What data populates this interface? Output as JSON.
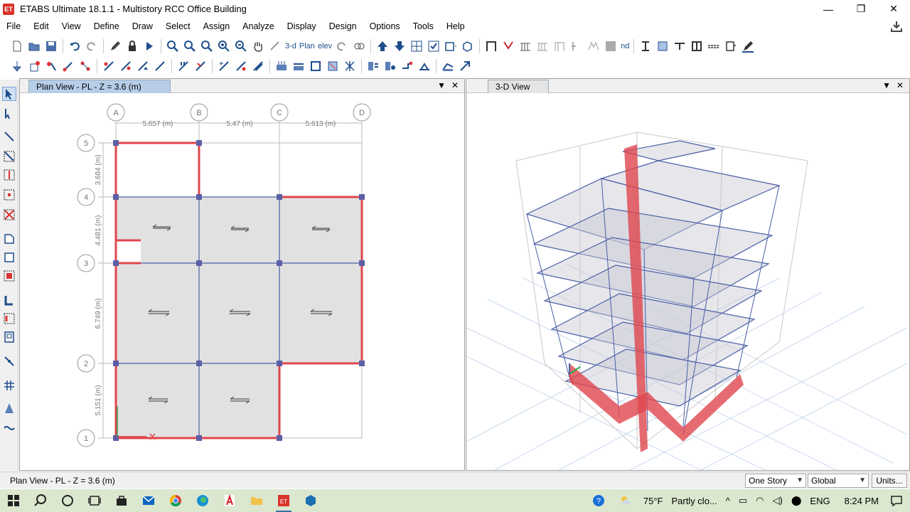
{
  "window": {
    "title": "ETABS Ultimate 18.1.1 - Multistory RCC Office Building",
    "logo": "ET",
    "minimize": "—",
    "restore": "❐",
    "close": "✕"
  },
  "menu": [
    "File",
    "Edit",
    "View",
    "Define",
    "Draw",
    "Select",
    "Assign",
    "Analyze",
    "Display",
    "Design",
    "Options",
    "Tools",
    "Help"
  ],
  "toolbar": {
    "view3d_label": "3-d",
    "plan_label": "Plan",
    "elev_label": "elev",
    "nd_label": "nd"
  },
  "plan_view": {
    "tab": "Plan View - PL - Z = 3.6 (m)",
    "grid_x": [
      "A",
      "B",
      "C",
      "D"
    ],
    "grid_y": [
      "5",
      "4",
      "3",
      "2",
      "1"
    ],
    "dims_x": [
      "5.657 (m)",
      "5.47 (m)",
      "5.613 (m)"
    ],
    "dims_y": [
      "3.684 (m)",
      "4.481 (m)",
      "6.749 (m)",
      "5.151 (m)"
    ]
  },
  "view3d": {
    "tab": "3-D View"
  },
  "status": {
    "text": "Plan View - PL - Z = 3.6 (m)",
    "story": "One Story",
    "coord": "Global",
    "units": "Units..."
  },
  "taskbar": {
    "weather_temp": "75°F",
    "weather_text": "Partly clo...",
    "lang": "ENG",
    "time": "8:24 PM"
  },
  "colors": {
    "accent": "#b7cde8",
    "beam": "#e0464d",
    "grid": "#4a5fa5",
    "taskbar": "#dbe8cf"
  }
}
